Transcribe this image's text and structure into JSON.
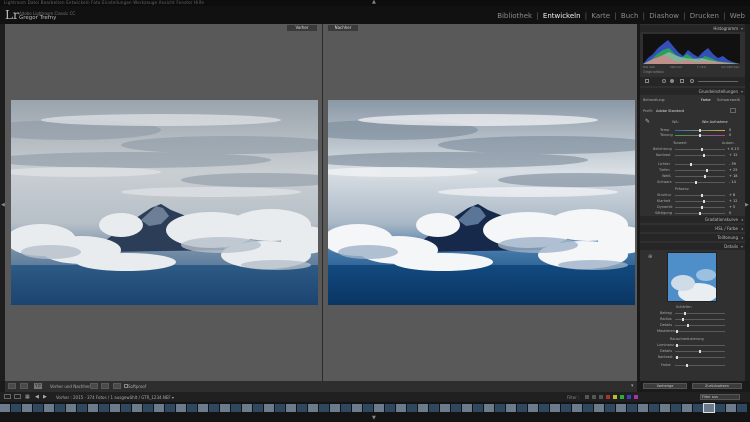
{
  "os_menu": "Lightroom  Datei  Bearbeiten  Entwickeln  Foto  Einstellungen  Werkzeuge  Ansicht  Fenster  Hilfe",
  "identity": {
    "logo": "Lr",
    "catalog_line1": "Adobe Lightroom Classic CC",
    "catalog_line2": "Gregor Trefny"
  },
  "modules": {
    "items": [
      "Bibliothek",
      "Entwickeln",
      "Karte",
      "Buch",
      "Diashow",
      "Drucken",
      "Web"
    ],
    "separator": "|",
    "active": "Entwickeln"
  },
  "compare": {
    "before_label": "Vorher",
    "after_label": "Nachher"
  },
  "toolbar": {
    "view_label": "Y|Y",
    "mode_label": "Vorher und Nachher:",
    "softproof_label": "Softproof"
  },
  "right_panel": {
    "histogram_title": "Histogramm",
    "histogram_info": [
      "ISO 100",
      "200 mm",
      "f / 8,0",
      "1/1.000 Sek."
    ],
    "original_photo": "Originalfoto",
    "grundeinstellungen": "Grundeinstellungen",
    "behandlung_label": "Behandlung:",
    "behandlung_options": [
      "Farbe",
      "Schwarzweiß"
    ],
    "profil_label": "Profil:",
    "profil_value": "Adobe Standard",
    "wa_label": "WA:",
    "wa_value": "Wie Aufnahme",
    "wb_sliders": [
      {
        "label": "Temp",
        "value": "0"
      },
      {
        "label": "Tönung",
        "value": "0"
      }
    ],
    "tone_title": "Tonwert",
    "tone_auto": "Autom.",
    "tone_sliders": [
      {
        "label": "Belichtung",
        "value": "+ 0,13"
      },
      {
        "label": "Kontrast",
        "value": "+ 12"
      },
      {
        "label": "Lichter",
        "value": "- 39"
      },
      {
        "label": "Tiefen",
        "value": "+ 25"
      },
      {
        "label": "Weiß",
        "value": "+ 18"
      },
      {
        "label": "Schwarz",
        "value": "- 14"
      }
    ],
    "presence_title": "Präsenz",
    "presence_sliders": [
      {
        "label": "Struktur",
        "value": "+ 8"
      },
      {
        "label": "Klarheit",
        "value": "+ 12"
      },
      {
        "label": "Dynamik",
        "value": "+ 5"
      },
      {
        "label": "Sättigung",
        "value": "0"
      }
    ],
    "sections": [
      "Gradationskurve",
      "HSL / Farbe",
      "Teiltonung",
      "Details"
    ],
    "detail_sharpen": "Schärfen",
    "detail_sharpen_sliders": [
      "Betrag",
      "Radius",
      "Details",
      "Maskieren"
    ],
    "detail_noise": "Rauschreduzierung",
    "detail_noise_sliders": [
      "Luminanz",
      "Details",
      "Kontrast",
      "Farbe"
    ],
    "btn_prev": "Vorherige",
    "btn_reset": "Zurücksetzen"
  },
  "filmstrip": {
    "source_label": "Vorher : 2015 · 374 Fotos / 1 ausgewählt / GTR_1234.NEF ▾",
    "filter_label": "Filter :",
    "filter_value": "Filter aus"
  },
  "colors": {
    "accent_active": "#f0f0f0",
    "panel_bg": "#303030",
    "canvas_bg": "#595959"
  }
}
